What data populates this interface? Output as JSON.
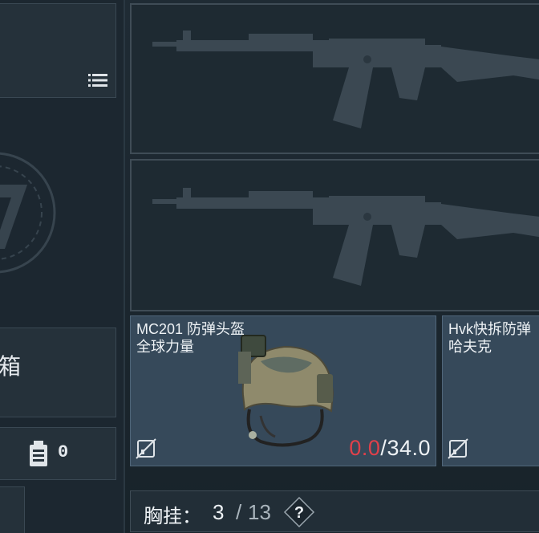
{
  "left_panel": {
    "list_icon": "list-icon",
    "box_label": "箱",
    "count_icon": "clipboard-icon",
    "count_value": "0"
  },
  "weapons": {
    "primary_icon": "rifle-silhouette-icon",
    "secondary_icon": "rifle-silhouette-icon"
  },
  "helmet_card": {
    "name": "MC201 防弹头盔",
    "subtitle": "全球力量",
    "durability_current": "0.0",
    "durability_sep": "/",
    "durability_max": "34.0",
    "insure_icon": "no-insurance-icon",
    "colors": {
      "durability_low": "#e0404a",
      "card_bg": "#36495a"
    }
  },
  "armor_card": {
    "name": "Hvk快拆防弹",
    "subtitle": "哈夫克",
    "insure_icon": "no-insurance-icon"
  },
  "chest_rig": {
    "label": "胸挂：",
    "current": "3",
    "slash": "/",
    "max": "13",
    "help_label": "?"
  }
}
